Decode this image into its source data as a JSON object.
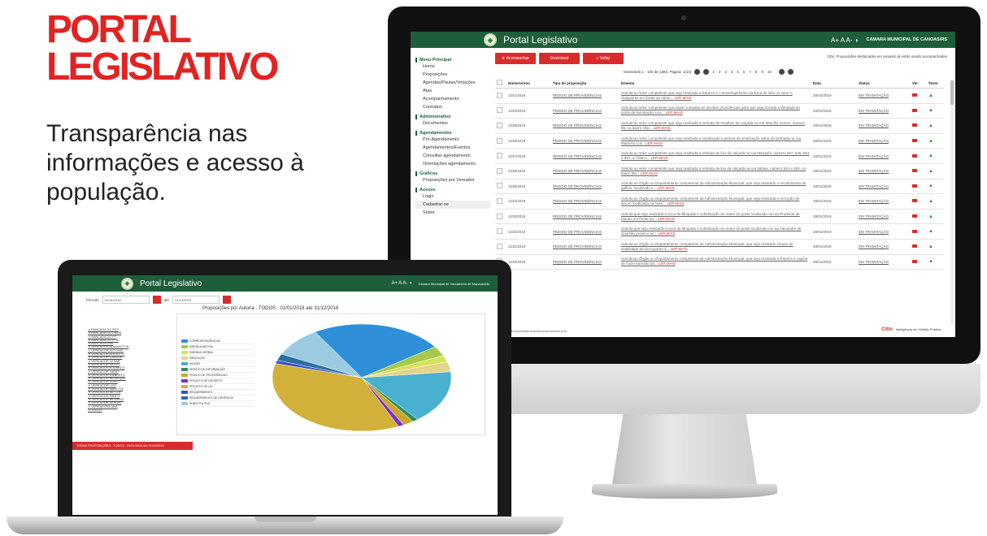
{
  "headline": {
    "line1": "PORTAL",
    "line2": "LEGISLATIVO"
  },
  "tagline": "Transparência nas informações e acesso à população.",
  "monitor": {
    "app_title": "Portal Legislativo",
    "font_tools": "A+  A  A-  ◑",
    "camara": "CAMARA MUNICIPAL DE CANOAS/RS",
    "sidebar": [
      {
        "section": "Menu Principal",
        "items": [
          "Home",
          "Proposições",
          "Agendas/Pautas/Votações",
          "Atas",
          "Acompanhamento",
          "Contratos"
        ]
      },
      {
        "section": "Administrativo",
        "items": [
          "Documentos"
        ]
      },
      {
        "section": "Agendamentos",
        "items": [
          "Pré-Agendamento",
          "Agendamentos/Eventos",
          "Consultar agendamento",
          "Orientações agendamento"
        ]
      },
      {
        "section": "Gráficos",
        "items": [
          "Proposições por Vereador"
        ]
      },
      {
        "section": "Acesso",
        "items": [
          "Login",
          "Cadastrar-se",
          "Sobre"
        ]
      }
    ],
    "buttons": [
      "Acompanhar",
      "Download",
      "Voltar"
    ],
    "note": "Obs: Proposições destacadas em amarelo já estão sendo acompanhadas",
    "pagination": {
      "label": "Mostrando 1 - 100 de 1382, Página: 1/14)",
      "pages": [
        "1",
        "2",
        "3",
        "4",
        "5",
        "6",
        "7",
        "8",
        "9",
        "10"
      ]
    },
    "columns": [
      "Número/Ano",
      "Tipo de proposição",
      "Ementa",
      "Data",
      "Status",
      "Ver",
      "Texto"
    ],
    "read_more": "LER MAIS",
    "rows": [
      {
        "numero": "1241/2019",
        "tipo": "PEDIDO DE PROVIDÊNCIAS",
        "ementa": "Solicita ao setor competente que seja realizada a limpeza e o desentupimento da boca de lobo no setor A Guajuviras em frente ao núme...",
        "data": "28/01/2019",
        "status": "EM TRAMITAÇÃO"
      },
      {
        "numero": "1240/2019",
        "tipo": "PEDIDO DE PROVIDÊNCIAS",
        "ementa": "Solicita ao setor competente que sejam tomadas as devidas providências para que seja trocada a lâmpada do poste de iluminação loca...",
        "data": "28/01/2019",
        "status": "EM TRAMITAÇÃO"
      },
      {
        "numero": "1239/2019",
        "tipo": "PEDIDO DE PROVIDÊNCIAS",
        "ementa": "Solicita ao setor competente que seja realizada a retirada de entulhos da calçada na rua Marcílio Lemos, número 89, no bairro Olar...",
        "data": "28/01/2019",
        "status": "EM TRAMITAÇÃO"
      },
      {
        "numero": "1238/2019",
        "tipo": "PEDIDO DE PROVIDÊNCIAS",
        "ementa": "Solicita ao setor competente que seja realizada a sinalização e pintura de sinalização viária da lombada na rua Martinho Lut...",
        "data": "28/01/2019",
        "status": "EM TRAMITAÇÃO"
      },
      {
        "numero": "1237/2019",
        "tipo": "PEDIDO DE PROVIDÊNCIAS",
        "ementa": "Solicita ao setor competente que seja realizada a retirada de lixo da calçada na rua Marquês, número 567, 535, 564 e 681, no bairro...",
        "data": "28/01/2019",
        "status": "EM TRAMITAÇÃO"
      },
      {
        "numero": "1236/2019",
        "tipo": "PEDIDO DE PROVIDÊNCIAS",
        "ementa": "Solicita ao setor competente que seja realizada a retirada de lixo da calçada na rua Itatiaia, número 544 e 569, no bairro Ma...",
        "data": "28/01/2019",
        "status": "EM TRAMITAÇÃO"
      },
      {
        "numero": "1235/2019",
        "tipo": "PEDIDO DE PROVIDÊNCIAS",
        "ementa": "Solicita ao Órgão ou Departamento competente da Administração Municipal, que seja realizado o recolhimento de galhos, localizado n...",
        "data": "28/01/2019",
        "status": "EM TRAMITAÇÃO"
      },
      {
        "numero": "1234/2019",
        "tipo": "PEDIDO DE PROVIDÊNCIAS",
        "ementa": "Solicita ao Órgão ou Departamento competente da Administração Municipal, que seja realizada a remoção de árvore localizada na Aven...",
        "data": "28/01/2019",
        "status": "EM TRAMITAÇÃO"
      },
      {
        "numero": "1233/2019",
        "tipo": "PEDIDO DE PROVIDÊNCIAS",
        "ementa": "Solicita que seja realizada a troca de lâmpada e substituição do reator do poste localizado na rua Prudente de Morais em frente ao...",
        "data": "28/01/2019",
        "status": "EM TRAMITAÇÃO"
      },
      {
        "numero": "1232/2019",
        "tipo": "PEDIDO DE PROVIDÊNCIAS",
        "ementa": "Solicita que seja realizada a troca de lâmpada e substituição do reator do poste localizado na rua Alexandre de Gusmão próximo ao...",
        "data": "28/01/2019",
        "status": "EM TRAMITAÇÃO"
      },
      {
        "numero": "1231/2019",
        "tipo": "PEDIDO DE PROVIDÊNCIAS",
        "ementa": "Solicita ao Órgão ou Departamento competente da Administração Municipal, que seja realizado estudo de viabilidade técnica quanto à...",
        "data": "28/01/2019",
        "status": "EM TRAMITAÇÃO"
      },
      {
        "numero": "1230/2019",
        "tipo": "PEDIDO DE PROVIDÊNCIAS",
        "ementa": "Solicita ao Órgão ou Departamento competente da Administração Municipal, que seja realizada a limpeza e capina de toda extensão da...",
        "data": "28/01/2019",
        "status": "EM TRAMITAÇÃO"
      }
    ],
    "footer_url": "...ltvo/portal/proposicao/proposicoes.php",
    "citto": {
      "brand": "Citto",
      "slogan": "Inteligência em Gestão Pública"
    }
  },
  "laptop": {
    "app_title": "Portal Legislativo",
    "font_tools": "A+  A  A-  ◑",
    "camara": "Câmara Municipal de Vereadores de Manaus/AM",
    "filter": {
      "label_from": "Período",
      "from": "01/01/2018",
      "label_to": "até",
      "to": "31/12/2018"
    },
    "chart_title": "Proposições por Autoria - TODOS - 01/01/2018 ate 31/12/2018",
    "list": [
      "BANCADA DO PDT",
      "BANCADA DO PMDB",
      "BANCADA DO PT",
      "BANCADA DO PTB",
      "BANCADA PSB",
      "VEREADOR ADAMASTOR",
      "VEREADOR ANTONIO",
      "VEREADOR AUGUSTO",
      "VEREADOR CARLOS",
      "VEREADOR CESAR",
      "VEREADOR DIOGO",
      "VEREADOR EDUARDO",
      "VEREADOR FABIO",
      "VEREADOR GILBERTO",
      "VEREADOR HENRIQUE",
      "VEREADOR JOAO",
      "VEREADOR LUIZ",
      "VEREADOR MARCOS",
      "VEREADOR NILTON",
      "VEREADOR PAULO",
      "VEREADOR RICARDO",
      "VEREADOR SERGIO",
      "VEREADORA ANA",
      "TODOS"
    ],
    "status_bar": "TODAS PROPOSIÇÕES - TODOS - 01/01/2018 até 31/12/2018",
    "colors": {
      "header": "#1d5e3b",
      "accent": "#d92b2b"
    }
  },
  "chart_data": {
    "type": "pie",
    "title": "Proposições por Autoria - TODOS - 01/01/2018 ate 31/12/2018",
    "slices": [
      {
        "label": "CORRESPONDÊNCIAS",
        "value": 24,
        "color": "#2f8fd8"
      },
      {
        "label": "EMENDA ADITIVA",
        "value": 3,
        "color": "#a6c94a"
      },
      {
        "label": "EMENDA VERBAL",
        "value": 2,
        "color": "#d6e25a"
      },
      {
        "label": "INDICAÇÃO",
        "value": 3,
        "color": "#e5d48a"
      },
      {
        "label": "MOÇÃO",
        "value": 16,
        "color": "#4ab0cf"
      },
      {
        "label": "PEDIDO DE INFORMAÇÃO",
        "value": 1,
        "color": "#2a8f5a"
      },
      {
        "label": "PEDIDO DE PROVIDÊNCIAS",
        "value": 2,
        "color": "#c9a630"
      },
      {
        "label": "PROJETO DE DECRETO",
        "value": 1,
        "color": "#7d2fc9"
      },
      {
        "label": "PROJETO DE LEI",
        "value": 36,
        "color": "#d1b13a"
      },
      {
        "label": "REQUERIMENTO",
        "value": 1,
        "color": "#3b4fc9"
      },
      {
        "label": "REQUERIMENTO DE URGÊNCIA",
        "value": 2,
        "color": "#2b6fa5"
      },
      {
        "label": "SUBSTITUTIVO",
        "value": 9,
        "color": "#9bcbe0"
      }
    ]
  }
}
